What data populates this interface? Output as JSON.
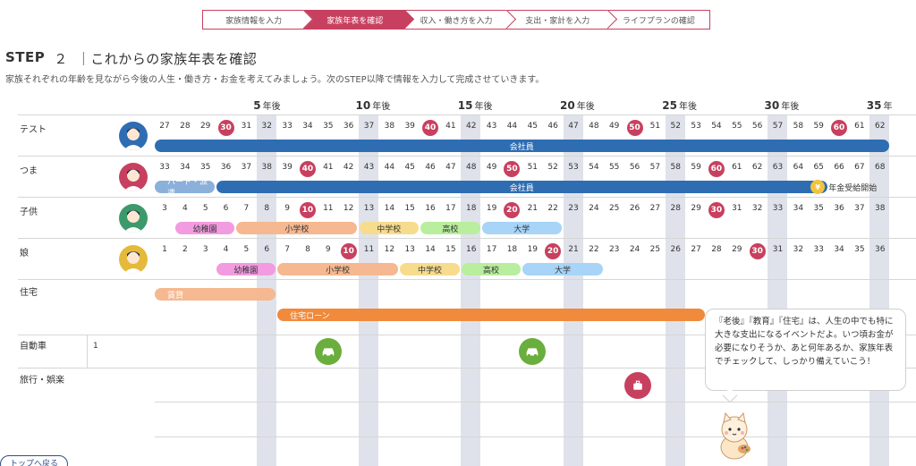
{
  "stepper": [
    {
      "label": "家族情報を入力",
      "active": false
    },
    {
      "label": "家族年表を確認",
      "active": true
    },
    {
      "label": "収入・働き方を入力",
      "active": false
    },
    {
      "label": "支出・家計を入力",
      "active": false
    },
    {
      "label": "ライフプランの確認",
      "active": false
    }
  ],
  "header": {
    "step": "STEP",
    "step_no": "２",
    "title": "｜これからの家族年表を確認",
    "subtitle": "家族それぞれの年齢を見ながら今後の人生・働き方・お金を考えてみましょう。次のSTEP以降で情報を入力して完成させていきます。"
  },
  "milestones": [
    {
      "num": "5",
      "label": "年後"
    },
    {
      "num": "10",
      "label": "年後"
    },
    {
      "num": "15",
      "label": "年後"
    },
    {
      "num": "20",
      "label": "年後"
    },
    {
      "num": "25",
      "label": "年後"
    },
    {
      "num": "30",
      "label": "年後"
    },
    {
      "num": "35",
      "label": "年"
    }
  ],
  "members": [
    {
      "name": "テスト",
      "avatar_color": "#2f6db3",
      "ages": [
        "27",
        "28",
        "29",
        "30",
        "31",
        "32",
        "33",
        "34",
        "35",
        "36",
        "37",
        "38",
        "39",
        "40",
        "41",
        "42",
        "43",
        "44",
        "45",
        "46",
        "47",
        "48",
        "49",
        "50",
        "51",
        "52",
        "53",
        "54",
        "55",
        "56",
        "57",
        "58",
        "59",
        "60",
        "61",
        "62"
      ],
      "bars": [
        {
          "label": "会社員",
          "color": "#2f6db3"
        }
      ]
    },
    {
      "name": "つま",
      "avatar_color": "#c8405f",
      "ages": [
        "33",
        "34",
        "35",
        "36",
        "37",
        "38",
        "39",
        "40",
        "41",
        "42",
        "43",
        "44",
        "45",
        "46",
        "47",
        "48",
        "49",
        "50",
        "51",
        "52",
        "53",
        "54",
        "55",
        "56",
        "57",
        "58",
        "59",
        "60",
        "61",
        "62",
        "63",
        "64",
        "65",
        "66",
        "67",
        "68"
      ],
      "bars": [
        {
          "label": "パート・派遣",
          "color": "#8bb0da"
        },
        {
          "label": "会社員",
          "color": "#2f6db3"
        }
      ],
      "pension": {
        "coin": "¥",
        "label": "年金受給開始"
      }
    },
    {
      "name": "子供",
      "avatar_color": "#3c9a6a",
      "ages": [
        "3",
        "4",
        "5",
        "6",
        "7",
        "8",
        "9",
        "10",
        "11",
        "12",
        "13",
        "14",
        "15",
        "16",
        "17",
        "18",
        "19",
        "20",
        "21",
        "22",
        "23",
        "24",
        "25",
        "26",
        "27",
        "28",
        "29",
        "30",
        "31",
        "32",
        "33",
        "34",
        "35",
        "36",
        "37",
        "38"
      ],
      "bars": [
        {
          "label": "幼稚園",
          "color": "#f29be0"
        },
        {
          "label": "小学校",
          "color": "#f5b890"
        },
        {
          "label": "中学校",
          "color": "#f7dc8e"
        },
        {
          "label": "高校",
          "color": "#b8ee9d"
        },
        {
          "label": "大学",
          "color": "#a7d4f7"
        }
      ]
    },
    {
      "name": "娘",
      "avatar_color": "#e5b93a",
      "ages": [
        "1",
        "2",
        "3",
        "4",
        "5",
        "6",
        "7",
        "8",
        "9",
        "10",
        "11",
        "12",
        "13",
        "14",
        "15",
        "16",
        "17",
        "18",
        "19",
        "20",
        "21",
        "22",
        "23",
        "24",
        "25",
        "26",
        "27",
        "28",
        "29",
        "30",
        "31",
        "32",
        "33",
        "34",
        "35",
        "36"
      ],
      "bars": [
        {
          "label": "幼稚園",
          "color": "#f29be0"
        },
        {
          "label": "小学校",
          "color": "#f5b890"
        },
        {
          "label": "中学校",
          "color": "#f7dc8e"
        },
        {
          "label": "高校",
          "color": "#b8ee9d"
        },
        {
          "label": "大学",
          "color": "#a7d4f7"
        }
      ]
    }
  ],
  "rows": {
    "housing": {
      "label": "住宅",
      "bars": [
        {
          "label": "賃貸",
          "color": "#f5b890"
        },
        {
          "label": "住宅ローン",
          "color": "#f08a3c"
        }
      ]
    },
    "car": {
      "label": "自動車",
      "count": "1"
    },
    "travel": {
      "label": "旅行・娯楽"
    }
  },
  "bubble": {
    "text": "『老後』『教育』『住宅』は、人生の中でも特に大きな支出になるイベントだよ。いつ頃お金が必要になりそうか、あと何年あるか、家族年表でチェックして、しっかり備えていこう！"
  },
  "buttons": {
    "top": "トップへ戻る"
  },
  "colors": {
    "accent": "#c8405f",
    "band": "#dfe2ea",
    "car_icon": "#6aae3e"
  }
}
